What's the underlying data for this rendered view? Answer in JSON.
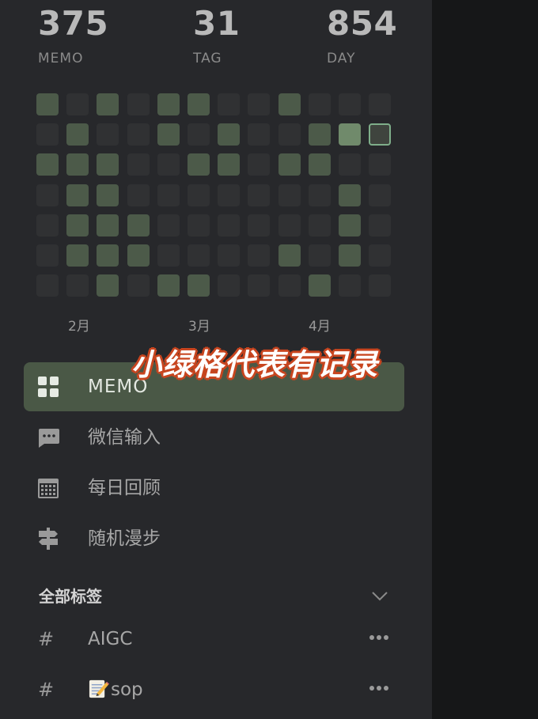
{
  "stats": [
    {
      "value": "375",
      "label": "MEMO"
    },
    {
      "value": "31",
      "label": "TAG"
    },
    {
      "value": "854",
      "label": "DAY"
    }
  ],
  "heatmap": {
    "rows": [
      [
        1,
        0,
        1,
        0,
        1,
        1,
        0,
        0,
        1,
        0,
        0,
        0
      ],
      [
        0,
        1,
        0,
        0,
        1,
        0,
        1,
        0,
        0,
        1,
        2,
        3
      ],
      [
        1,
        1,
        1,
        0,
        0,
        1,
        1,
        0,
        1,
        1,
        0,
        0
      ],
      [
        0,
        1,
        1,
        0,
        0,
        0,
        0,
        0,
        0,
        0,
        1,
        0
      ],
      [
        0,
        1,
        1,
        1,
        0,
        0,
        0,
        0,
        0,
        0,
        1,
        0
      ],
      [
        0,
        1,
        1,
        1,
        0,
        0,
        0,
        0,
        1,
        0,
        1,
        0
      ],
      [
        0,
        0,
        1,
        0,
        1,
        1,
        0,
        0,
        0,
        1,
        0,
        0
      ]
    ],
    "months": [
      "2月",
      "3月",
      "4月"
    ]
  },
  "overlay_caption": "小绿格代表有记录",
  "nav": {
    "items": [
      {
        "label": "MEMO",
        "icon": "grid-icon",
        "active": true
      },
      {
        "label": "微信输入",
        "icon": "chat-bubble-icon",
        "active": false
      },
      {
        "label": "每日回顾",
        "icon": "calendar-icon",
        "active": false
      },
      {
        "label": "随机漫步",
        "icon": "signpost-icon",
        "active": false
      }
    ]
  },
  "tags": {
    "header": "全部标签",
    "items": [
      {
        "hash": "#",
        "label": "AIGC"
      },
      {
        "hash": "#",
        "emoji": "memo-emoji-icon",
        "label": "sop"
      }
    ]
  },
  "colors": {
    "sidebar_bg": "#27282b",
    "active_bg": "#4a5846",
    "cell_empty": "#303133",
    "cell_low": "#4c5a49",
    "cell_high": "#708a6b",
    "today_border": "#7fae8a",
    "overlay_stroke": "#c8451f"
  }
}
